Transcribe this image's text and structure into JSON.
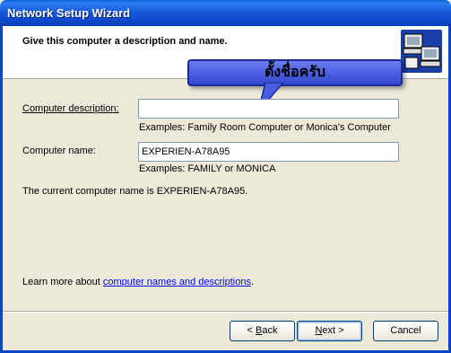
{
  "window": {
    "title": "Network Setup Wizard"
  },
  "header": {
    "heading": "Give this computer a description and name."
  },
  "callout": {
    "text": "ตั้งชื่อครับ"
  },
  "form": {
    "description_label": "Computer description:",
    "description_value": "",
    "description_hint": "Examples: Family Room Computer or Monica's Computer",
    "name_label": "Computer name:",
    "name_value": "EXPERIEN-A78A95",
    "name_hint": "Examples: FAMILY or MONICA",
    "current_name_text": "The current computer name is EXPERIEN-A78A95."
  },
  "learn_more": {
    "prefix": "Learn more about ",
    "link": "computer names and descriptions",
    "suffix": "."
  },
  "buttons": {
    "back_pre": "< ",
    "back_ul": "B",
    "back_post": "ack",
    "next_ul": "N",
    "next_post": "ext >",
    "cancel": "Cancel"
  },
  "icons": {
    "header_icon": "network-computers-icon"
  },
  "colors": {
    "titlebar": "#0b44c7",
    "callout": "#4a5de0",
    "link": "#0000ff"
  }
}
